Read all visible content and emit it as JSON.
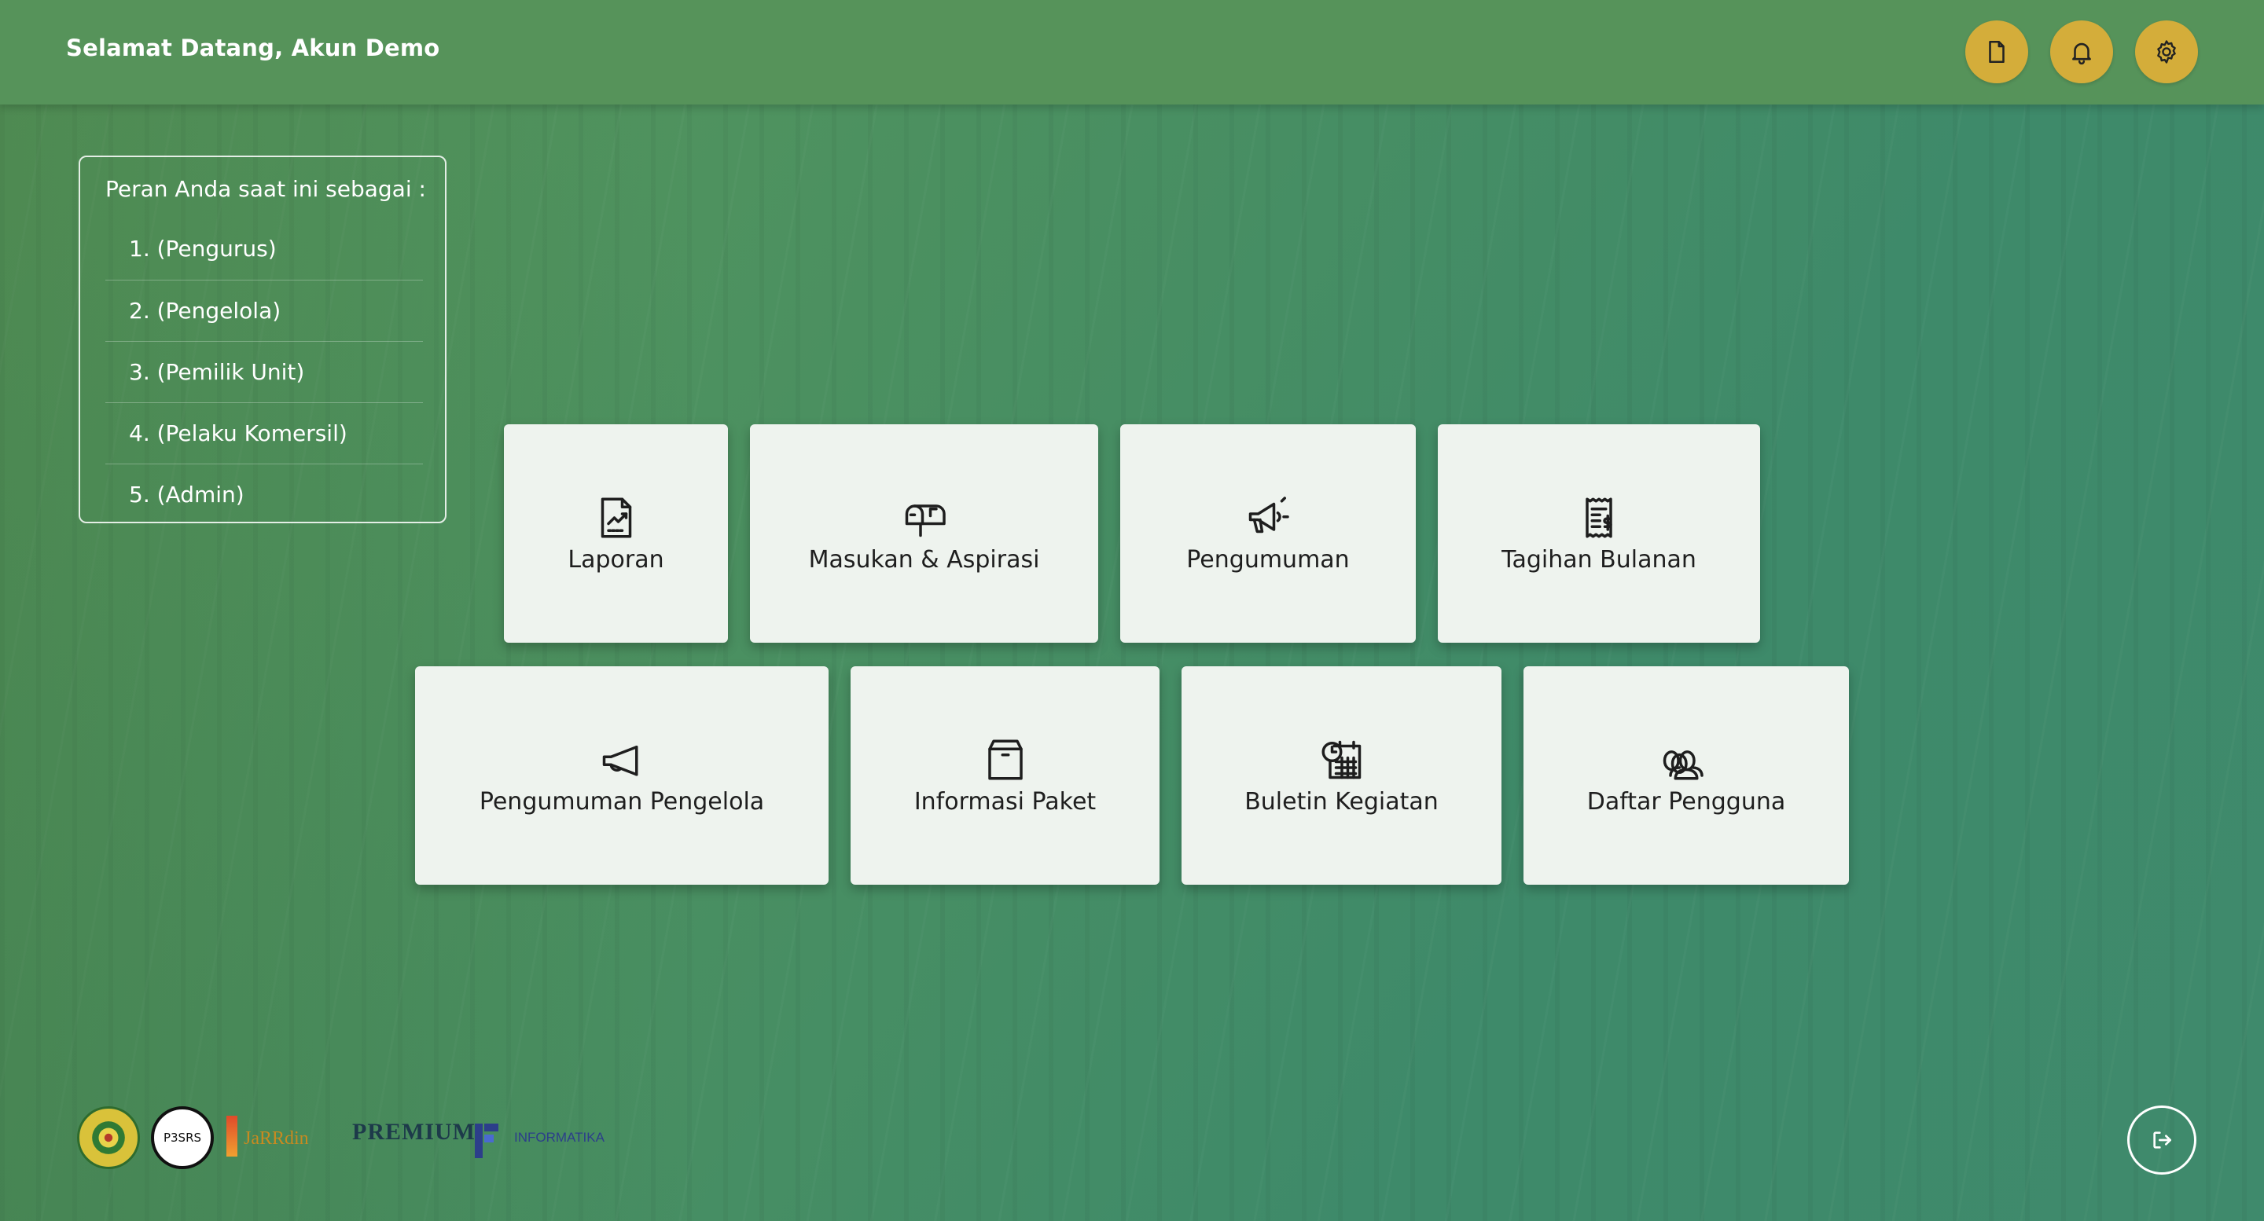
{
  "header": {
    "welcome": "Selamat Datang, Akun Demo",
    "buttons": [
      {
        "icon": "document-icon"
      },
      {
        "icon": "bell-icon"
      },
      {
        "icon": "gear-icon"
      }
    ]
  },
  "roles": {
    "title": "Peran Anda saat ini sebagai :",
    "items": [
      "1. (Pengurus)",
      "2. (Pengelola)",
      "3. (Pemilik Unit)",
      "4. (Pelaku Komersil)",
      "5. (Admin)"
    ]
  },
  "menu": {
    "row1": [
      {
        "label": "Laporan",
        "icon": "report-icon"
      },
      {
        "label": "Masukan & Aspirasi",
        "icon": "mailbox-icon"
      },
      {
        "label": "Pengumuman",
        "icon": "megaphone-icon"
      },
      {
        "label": "Tagihan Bulanan",
        "icon": "receipt-icon"
      }
    ],
    "row2": [
      {
        "label": "Pengumuman Pengelola",
        "icon": "megaphone-outline-icon"
      },
      {
        "label": "Informasi Paket",
        "icon": "package-icon"
      },
      {
        "label": "Buletin Kegiatan",
        "icon": "calendar-clock-icon"
      },
      {
        "label": "Daftar Pengguna",
        "icon": "users-icon"
      }
    ]
  },
  "footer": {
    "logos": {
      "p3srs": "P3SRS",
      "premium": "PREMIUM",
      "informatika": "INFORMATIKA",
      "premium_jarrdin": "JaRRdin"
    },
    "logout_icon": "logout-icon"
  },
  "colors": {
    "header": "#56935a",
    "accent": "#d4ad3a",
    "card": "#eef3ee"
  }
}
